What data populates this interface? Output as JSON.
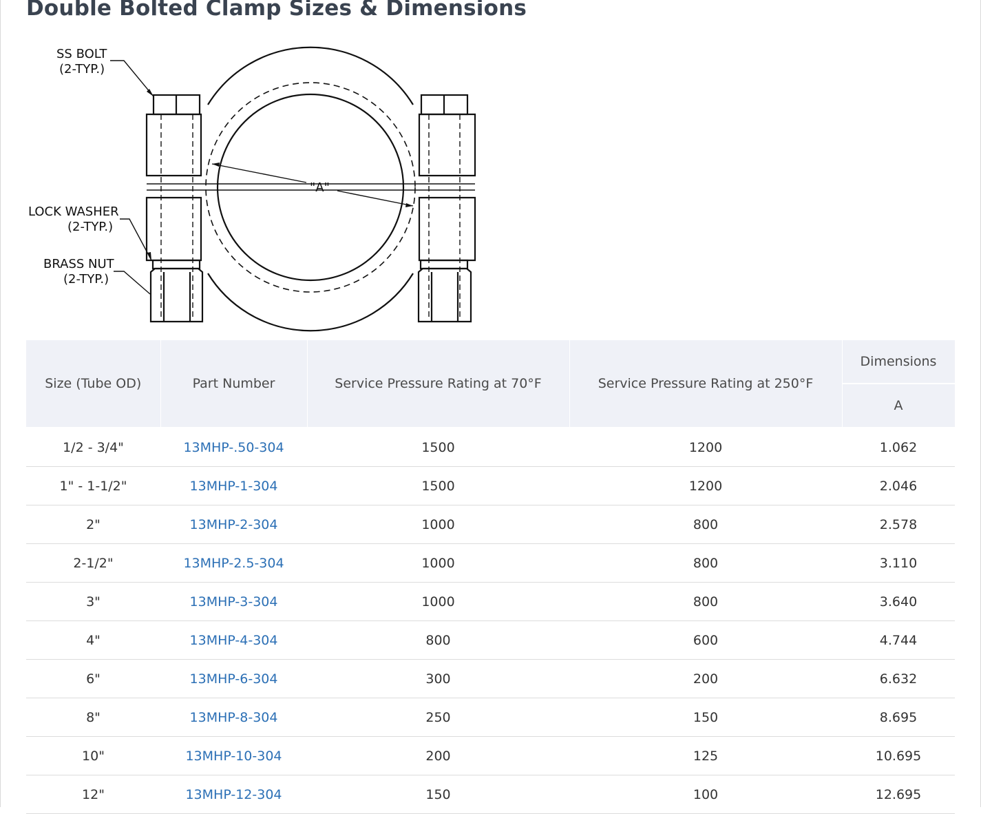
{
  "page": {
    "title": "Double Bolted Clamp Sizes & Dimensions"
  },
  "diagram": {
    "labels": {
      "ss_bolt": "SS BOLT",
      "ss_bolt_typ": "(2-TYP.)",
      "lock_washer": "LOCK WASHER",
      "lock_washer_typ": "(2-TYP.)",
      "brass_nut": "BRASS NUT",
      "brass_nut_typ": "(2-TYP.)",
      "dimension_a": "\"A\""
    }
  },
  "table": {
    "headers": {
      "size": "Size (Tube OD)",
      "part_number": "Part Number",
      "pressure_70": "Service Pressure Rating at 70°F",
      "pressure_250": "Service Pressure Rating at 250°F",
      "dimensions": "Dimensions",
      "dimension_a": "A"
    },
    "rows": [
      {
        "size": "1/2 - 3/4\"",
        "part": "13MHP-.50-304",
        "p70": "1500",
        "p250": "1200",
        "a": "1.062"
      },
      {
        "size": "1\" - 1-1/2\"",
        "part": "13MHP-1-304",
        "p70": "1500",
        "p250": "1200",
        "a": "2.046"
      },
      {
        "size": "2\"",
        "part": "13MHP-2-304",
        "p70": "1000",
        "p250": "800",
        "a": "2.578"
      },
      {
        "size": "2-1/2\"",
        "part": "13MHP-2.5-304",
        "p70": "1000",
        "p250": "800",
        "a": "3.110"
      },
      {
        "size": "3\"",
        "part": "13MHP-3-304",
        "p70": "1000",
        "p250": "800",
        "a": "3.640"
      },
      {
        "size": "4\"",
        "part": "13MHP-4-304",
        "p70": "800",
        "p250": "600",
        "a": "4.744"
      },
      {
        "size": "6\"",
        "part": "13MHP-6-304",
        "p70": "300",
        "p250": "200",
        "a": "6.632"
      },
      {
        "size": "8\"",
        "part": "13MHP-8-304",
        "p70": "250",
        "p250": "150",
        "a": "8.695"
      },
      {
        "size": "10\"",
        "part": "13MHP-10-304",
        "p70": "200",
        "p250": "125",
        "a": "10.695"
      },
      {
        "size": "12\"",
        "part": "13MHP-12-304",
        "p70": "150",
        "p250": "100",
        "a": "12.695"
      }
    ]
  },
  "colors": {
    "link": "#2b6fb5",
    "header_bg": "#eff1f7",
    "title": "#3a4350"
  }
}
